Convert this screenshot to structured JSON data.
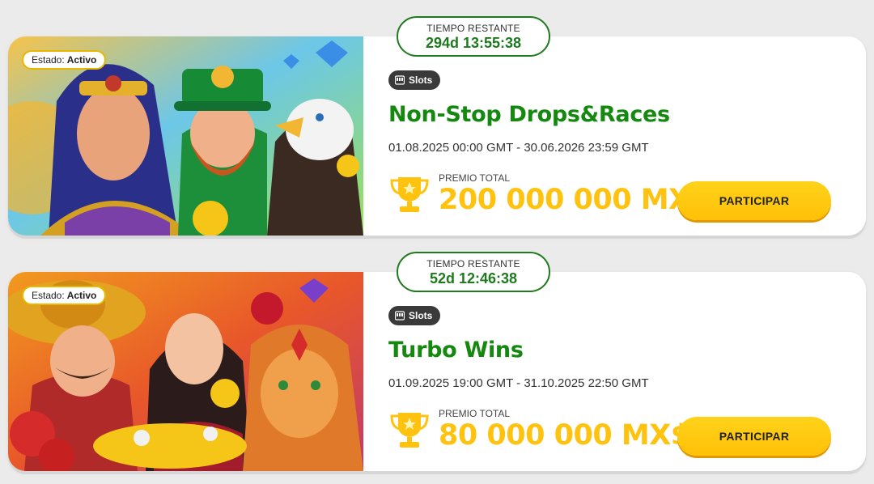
{
  "tournaments": [
    {
      "status_label": "Estado:",
      "status_value": "Activo",
      "timer_label": "TIEMPO RESTANTE",
      "timer_value": "294d 13:55:38",
      "category": "Slots",
      "title": "Non-Stop Drops&Races",
      "dates": "01.08.2025 00:00 GMT - 30.06.2026 23:59 GMT",
      "prize_label": "PREMIO TOTAL",
      "prize_value": "200 000 000 MX$",
      "button_label": "PARTICIPAR"
    },
    {
      "status_label": "Estado:",
      "status_value": "Activo",
      "timer_label": "TIEMPO RESTANTE",
      "timer_value": "52d 12:46:38",
      "category": "Slots",
      "title": "Turbo Wins",
      "dates": "01.09.2025 19:00 GMT - 31.10.2025 22:50 GMT",
      "prize_label": "PREMIO TOTAL",
      "prize_value": "80 000 000 MX$",
      "button_label": "PARTICIPAR"
    }
  ],
  "colors": {
    "title_green": "#15890f",
    "timer_green": "#1f7a1f",
    "prize_yellow": "#ffc20e",
    "button_yellow": "#ffc107",
    "tag_dark": "#3a3a3a"
  },
  "icons": {
    "category": "slot-machine-icon",
    "prize": "trophy-icon"
  }
}
